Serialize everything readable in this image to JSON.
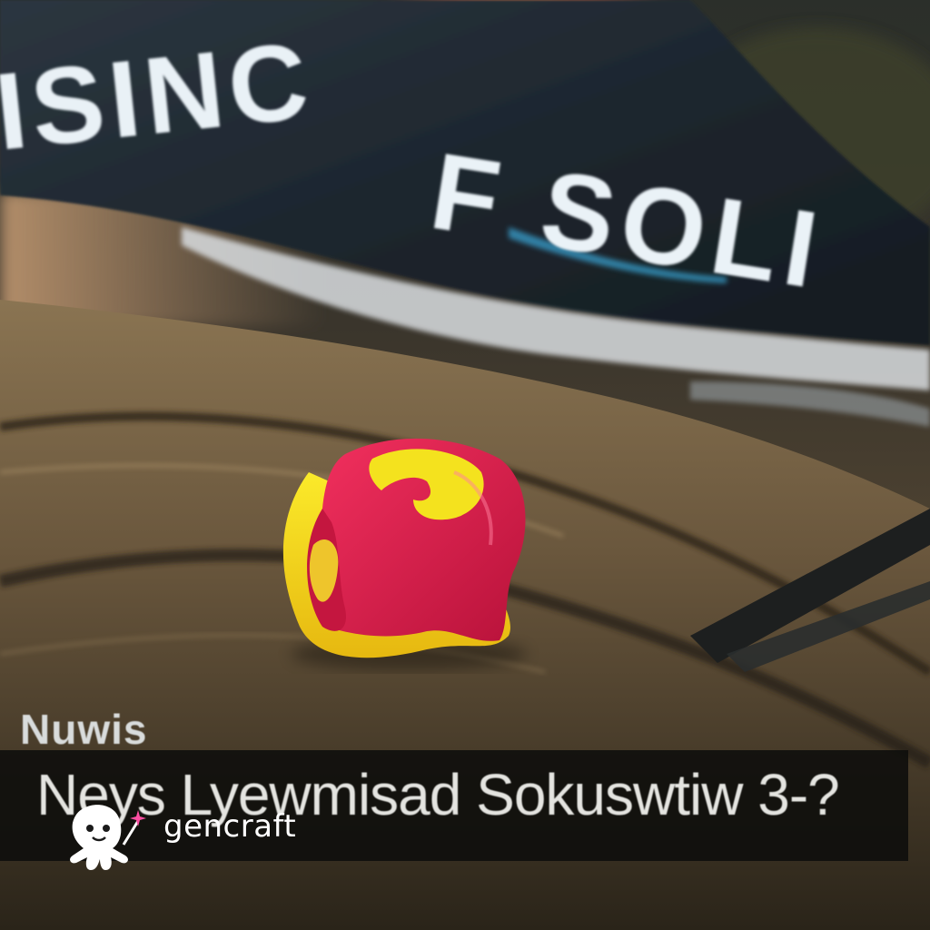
{
  "image": {
    "description_kind": "photo",
    "palette": {
      "sky_glow": "#e07a4a",
      "banner_dark": "#1f2a33",
      "banner_text": "#e9f1f6",
      "banner_edge_blue": "#3aa7d8",
      "metal_brown": "#6b5a44",
      "logo_red": "#e8204f",
      "logo_yellow": "#f6e21a"
    }
  },
  "banner": {
    "text": "ISINC F SOLI"
  },
  "overlay": {
    "corner_label": "Nuwis",
    "ticker": "Neys  Lyewmisad  Sokuswtiw 3-?"
  },
  "watermark": {
    "brand": "gencraft",
    "icon": "octopus-icon"
  }
}
